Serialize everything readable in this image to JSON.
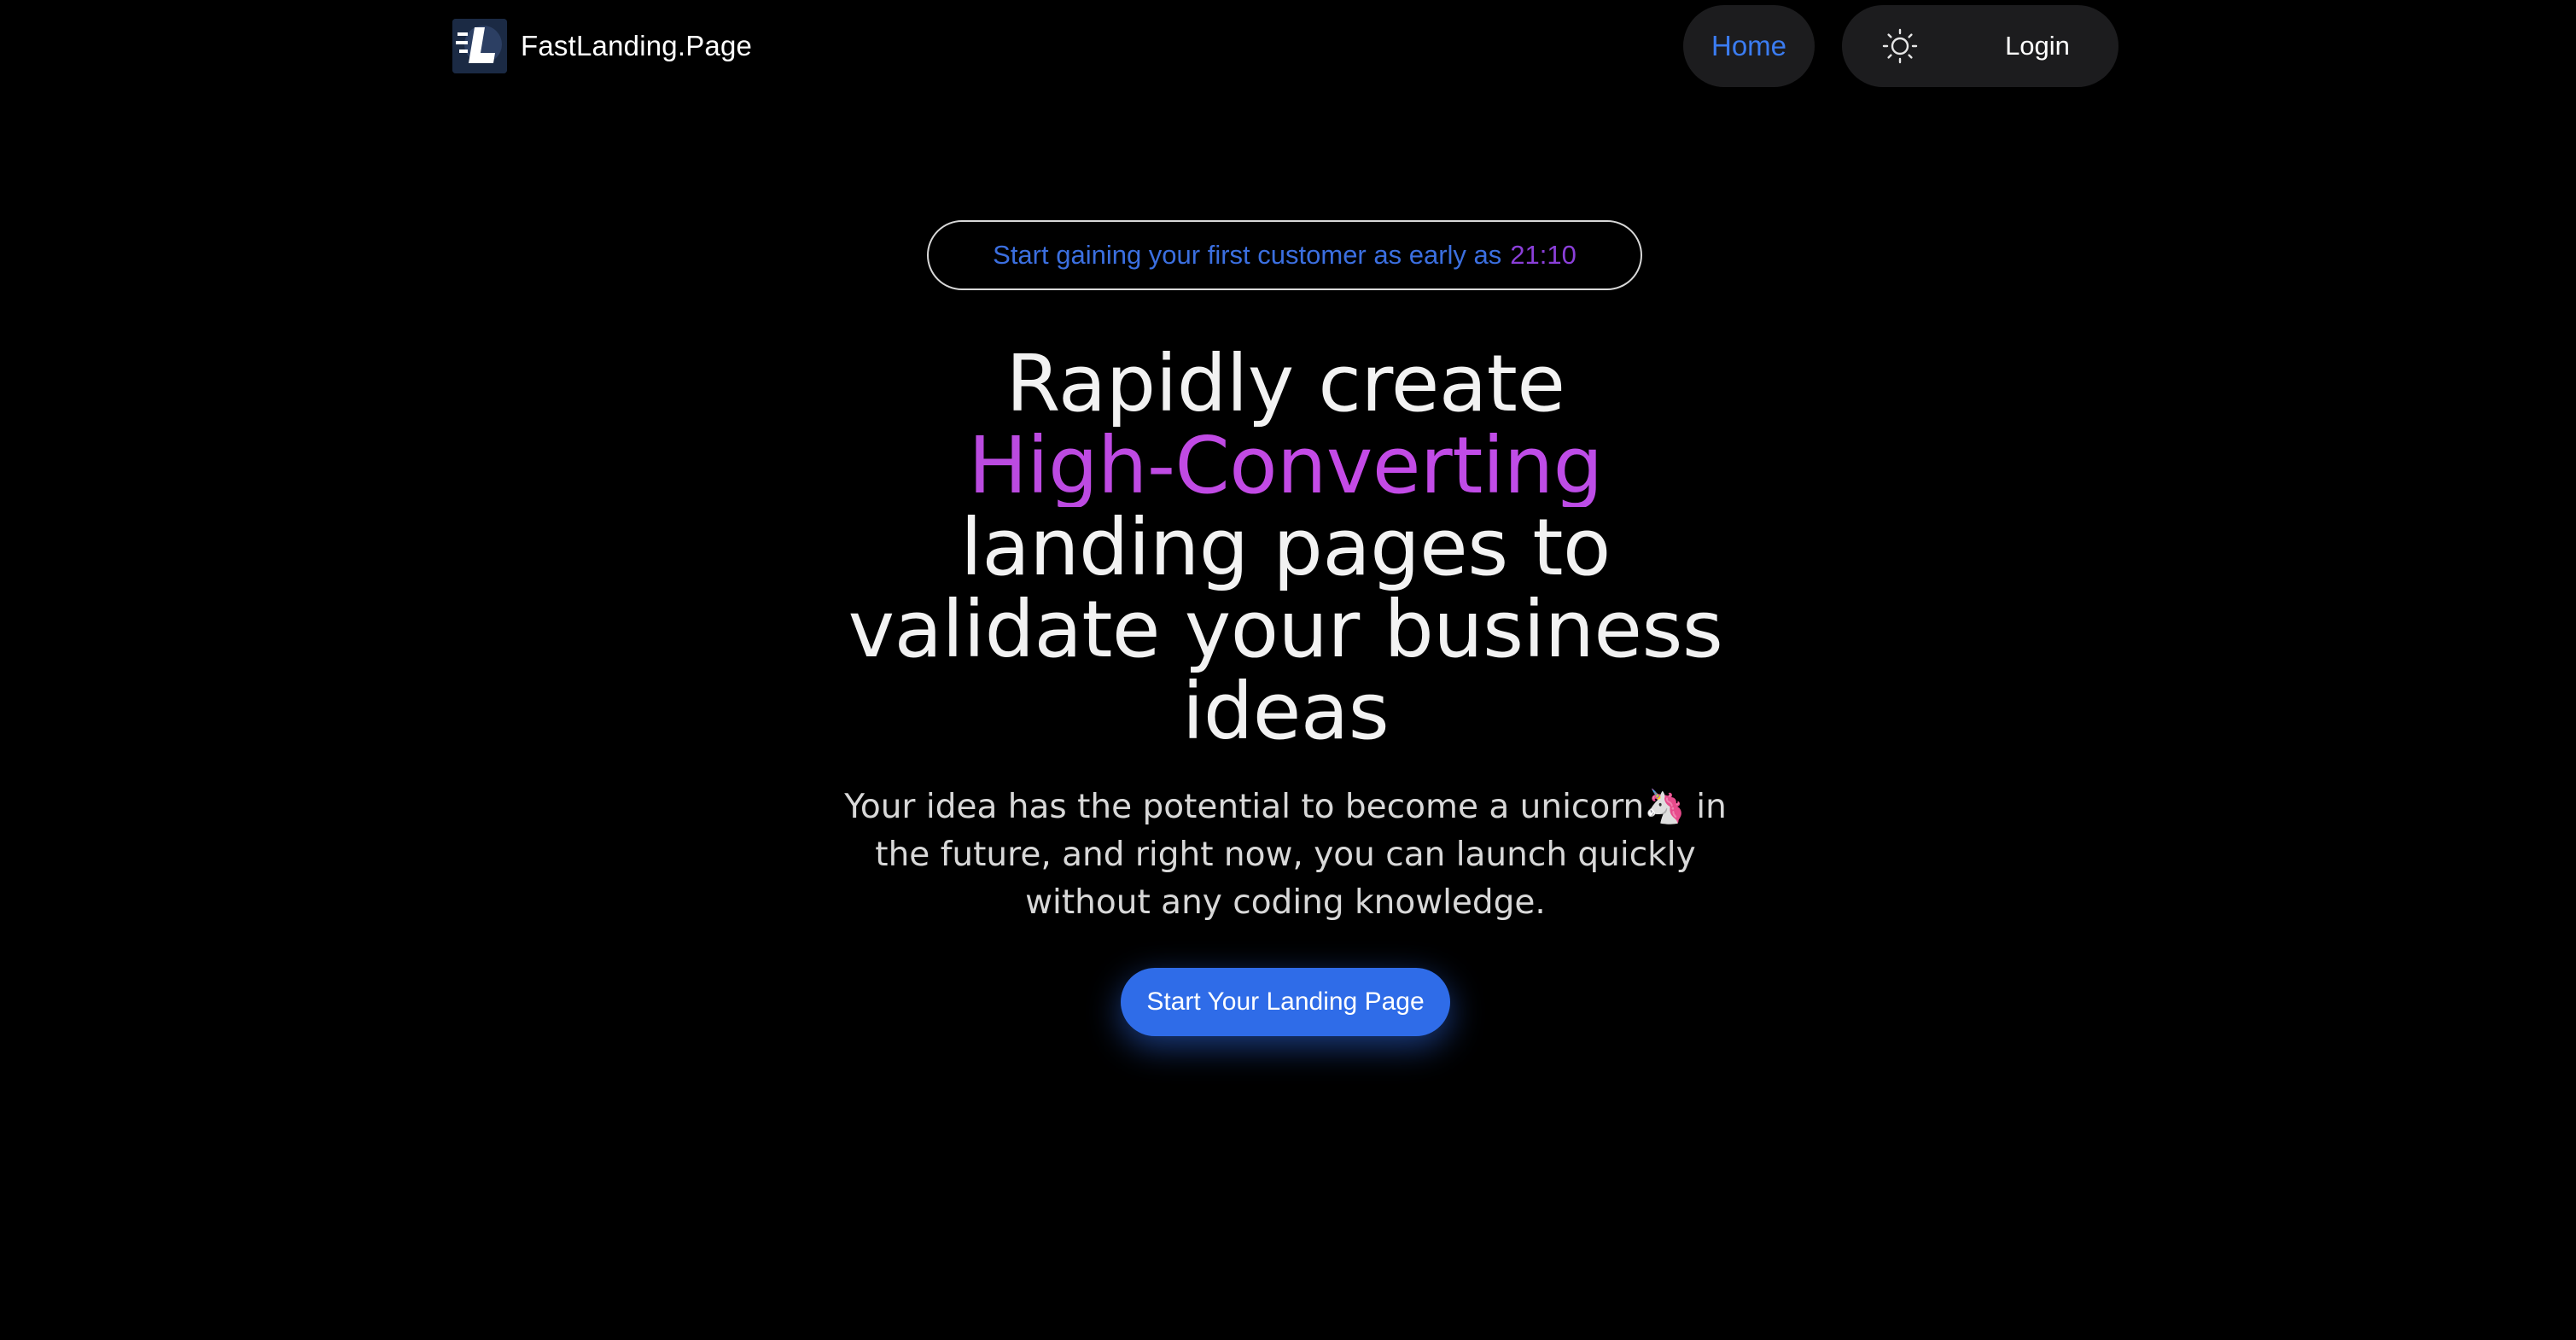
{
  "header": {
    "brand_name": "FastLanding.Page",
    "nav_home": "Home",
    "login": "Login",
    "theme_icon": "sun-icon"
  },
  "hero": {
    "announcement": {
      "text": "Start gaining your first customer as early as",
      "time": "21:10"
    },
    "headline": {
      "line1": "Rapidly create",
      "accent": "High-Converting",
      "line3": "landing pages to",
      "line4": "validate your business",
      "line5": "ideas"
    },
    "subtitle": {
      "before": "Your idea has the potential to become a unicorn",
      "emoji": "🦄",
      "after": " in the future, and right now, you can launch quickly without any coding knowledge."
    },
    "cta_label": "Start Your Landing Page"
  },
  "colors": {
    "background": "#000000",
    "accent_blue": "#2f6ce8",
    "nav_active": "#3b7cf1",
    "headline_accent": "#c44ae6",
    "announcement_time": "#8b3fd9"
  }
}
